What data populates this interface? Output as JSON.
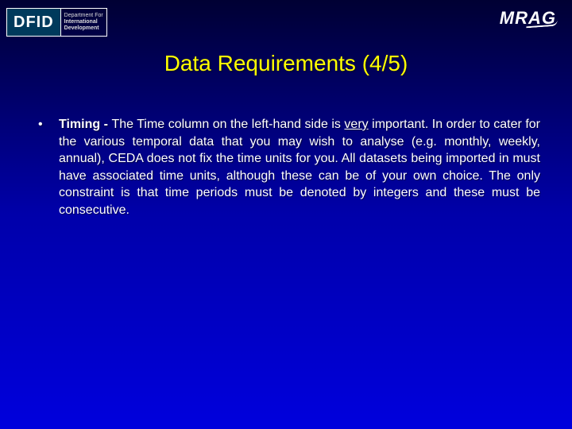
{
  "header": {
    "dfid_abbrev": "DFID",
    "dfid_line1": "Department For",
    "dfid_line2": "International",
    "dfid_line3": "Development",
    "mrag": "MRAG"
  },
  "title": "Data Requirements (4/5)",
  "bullet": {
    "lead": "Timing - ",
    "part1": "The Time column on the left-hand side is ",
    "emph": "very",
    "part2": " important. In order to cater for the various temporal data that you may wish to analyse (e.g. monthly, weekly, annual), CEDA does not fix the time units for you.  All datasets being imported in must have associated time units, although these can be of your own choice. The only constraint is that time periods must be denoted by integers and these must be consecutive."
  }
}
